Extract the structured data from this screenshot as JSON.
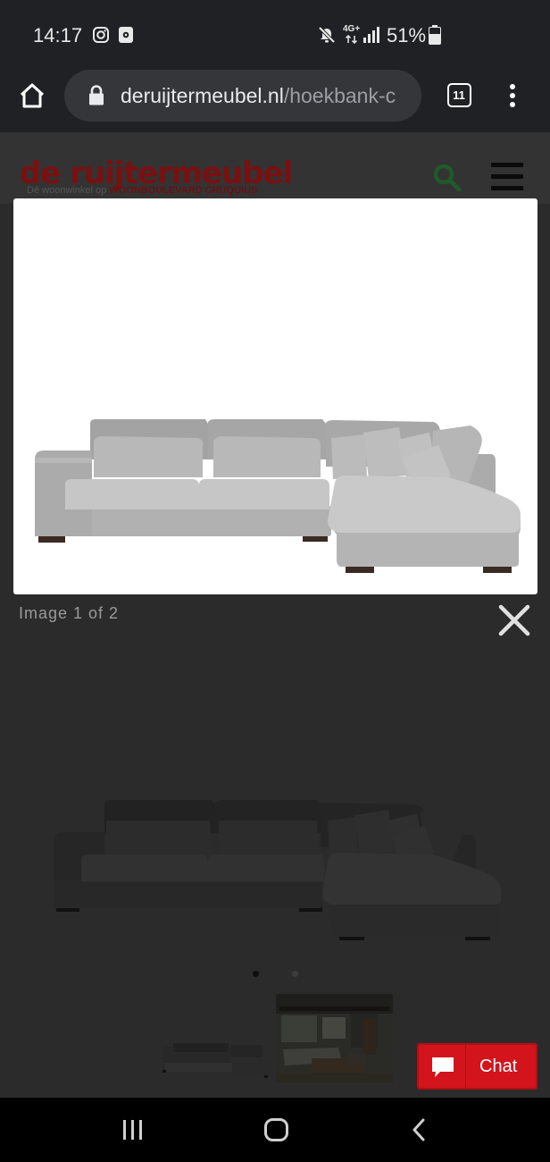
{
  "status_bar": {
    "time": "14:17",
    "network": "4G+",
    "battery": "51%",
    "icons": [
      "instagram-icon",
      "media-icon",
      "mute-icon",
      "data-arrows-icon",
      "signal-icon",
      "battery-icon"
    ]
  },
  "browser": {
    "url_host": "deruijtermeubel.nl",
    "url_path": "/hoekbank-c",
    "tab_count": "11",
    "icons": [
      "home-icon",
      "lock-icon",
      "tabs-icon",
      "more-icon"
    ]
  },
  "site": {
    "logo_text": "de ruijtermeubel",
    "tagline_prefix": "Dé woonwinkel op ",
    "tagline_bold": "WOONBOULEVARD CRUQUIUS",
    "icons": [
      "search-icon",
      "menu-icon"
    ]
  },
  "lightbox": {
    "caption": "Image 1 of 2",
    "current_index": 1,
    "total": 2
  },
  "chat": {
    "label": "Chat"
  },
  "colors": {
    "brand_red": "#d3141c",
    "logo_red": "#7a1010",
    "search_green": "#1f5a2a"
  }
}
